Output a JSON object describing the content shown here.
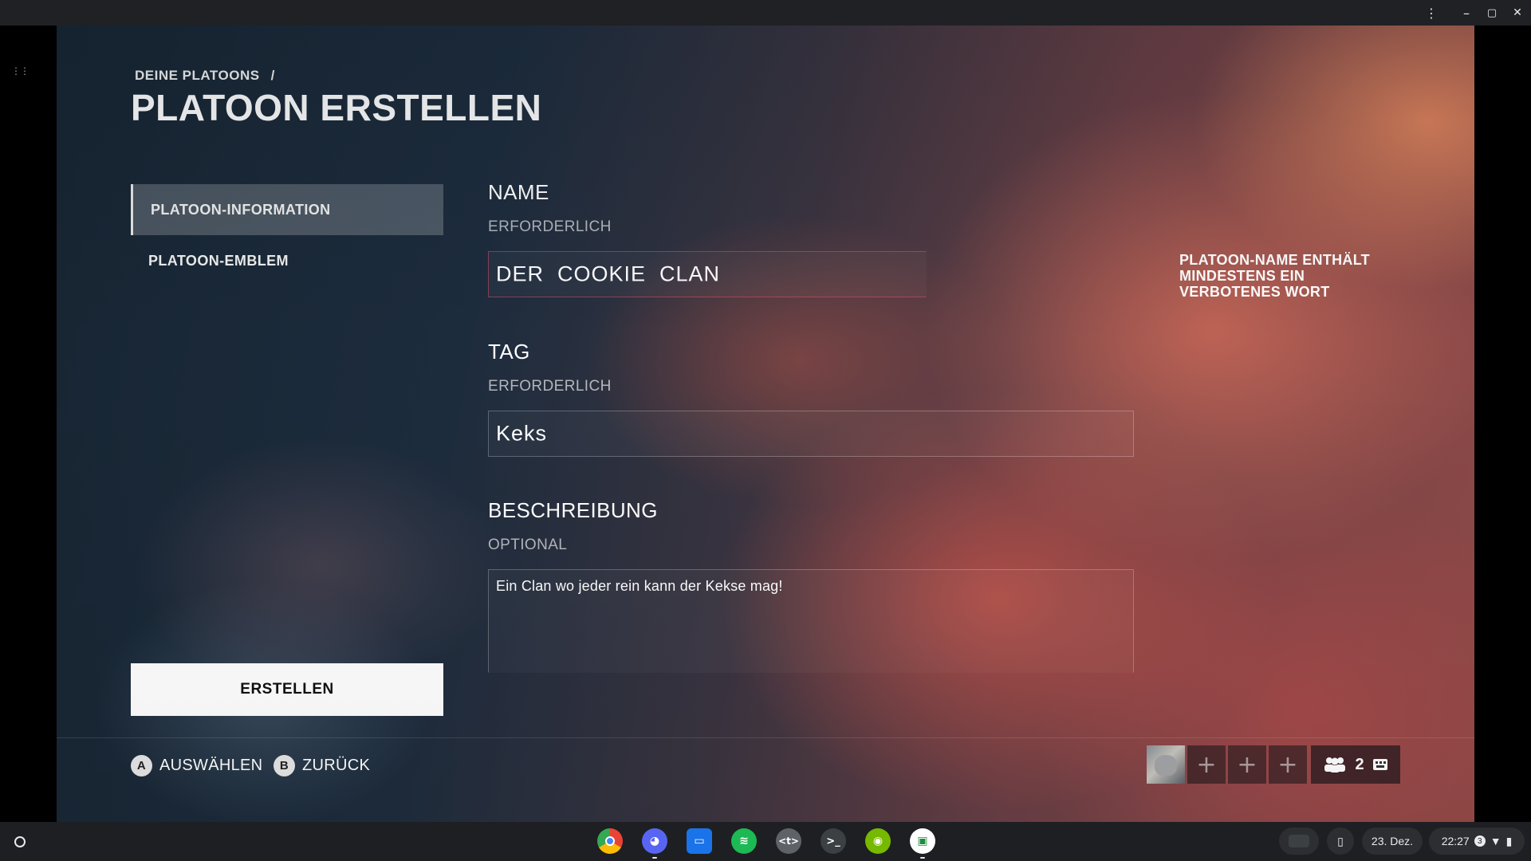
{
  "window": {
    "controls": {
      "menu_icon": "⋮",
      "minimize_icon": "–",
      "restore_icon": "▢",
      "close_icon": "✕"
    }
  },
  "page": {
    "breadcrumb": "DEINE PLATOONS",
    "breadcrumb_separator": "/",
    "title": "PLATOON ERSTELLEN"
  },
  "sidebar": {
    "items": [
      {
        "label": "PLATOON-INFORMATION",
        "active": true
      },
      {
        "label": "PLATOON-EMBLEM",
        "active": false
      }
    ]
  },
  "form": {
    "name": {
      "label": "NAME",
      "sub": "ERFORDERLICH",
      "value": "DER  COOKIE  CLAN"
    },
    "tag": {
      "label": "TAG",
      "sub": "ERFORDERLICH",
      "value": "Keks"
    },
    "description": {
      "label": "BESCHREIBUNG",
      "sub": "OPTIONAL",
      "value": "Ein Clan wo jeder rein kann der Kekse mag!"
    },
    "error": "PLATOON-NAME ENTHÄLT MINDESTENS EIN VERBOTENES WORT"
  },
  "actions": {
    "create_label": "ERSTELLEN"
  },
  "footer": {
    "hints": [
      {
        "key": "A",
        "label": "AUSWÄHLEN"
      },
      {
        "key": "B",
        "label": "ZURÜCK"
      }
    ],
    "party": {
      "slot_icon": "+",
      "count": "2",
      "people_icon": "people-icon",
      "extra_icon": "keyboard-icon"
    }
  },
  "shelf": {
    "apps": [
      "chrome-icon",
      "discord-icon",
      "files-icon",
      "spotify-icon",
      "terminal-code-icon",
      "terminal-icon",
      "nvidia-icon",
      "game-icon"
    ],
    "date": "23. Dez.",
    "time": "22:27",
    "notification_count": "3"
  }
}
